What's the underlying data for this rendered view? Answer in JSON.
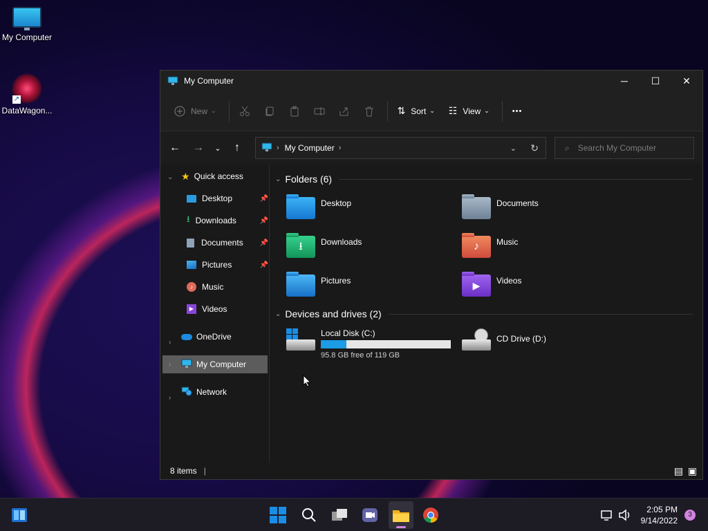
{
  "desktop": {
    "icons": [
      {
        "label": "My Computer",
        "icon": "monitor-icon"
      },
      {
        "label": "DataWagon...",
        "icon": "datawagon-logo-icon"
      }
    ]
  },
  "window": {
    "title": "My Computer",
    "controls": {
      "minimize": "─",
      "maximize": "☐",
      "close": "✕"
    }
  },
  "toolbar": {
    "new_label": "New",
    "sort_label": "Sort",
    "view_label": "View",
    "more_label": "•••"
  },
  "address": {
    "path": "My Computer",
    "search_placeholder": "Search My Computer"
  },
  "sidebar": {
    "quick_access": "Quick access",
    "items": [
      {
        "label": "Desktop",
        "pinned": true
      },
      {
        "label": "Downloads",
        "pinned": true
      },
      {
        "label": "Documents",
        "pinned": true
      },
      {
        "label": "Pictures",
        "pinned": true
      },
      {
        "label": "Music",
        "pinned": false
      },
      {
        "label": "Videos",
        "pinned": false
      }
    ],
    "onedrive": "OneDrive",
    "my_computer": "My Computer",
    "network": "Network"
  },
  "content": {
    "folders_header": "Folders (6)",
    "folders": [
      "Desktop",
      "Documents",
      "Downloads",
      "Music",
      "Pictures",
      "Videos"
    ],
    "drives_header": "Devices and drives (2)",
    "drives": [
      {
        "label": "Local Disk (C:)",
        "detail": "95.8 GB free of 119 GB",
        "used_fraction": 0.195
      },
      {
        "label": "CD Drive (D:)"
      }
    ]
  },
  "status": {
    "items": "8 items"
  },
  "taskbar": {
    "time": "2:05 PM",
    "date": "9/14/2022",
    "notifications": "3"
  },
  "colors": {
    "accent": "#1b9ce5",
    "selection": "#5c5c5c"
  }
}
